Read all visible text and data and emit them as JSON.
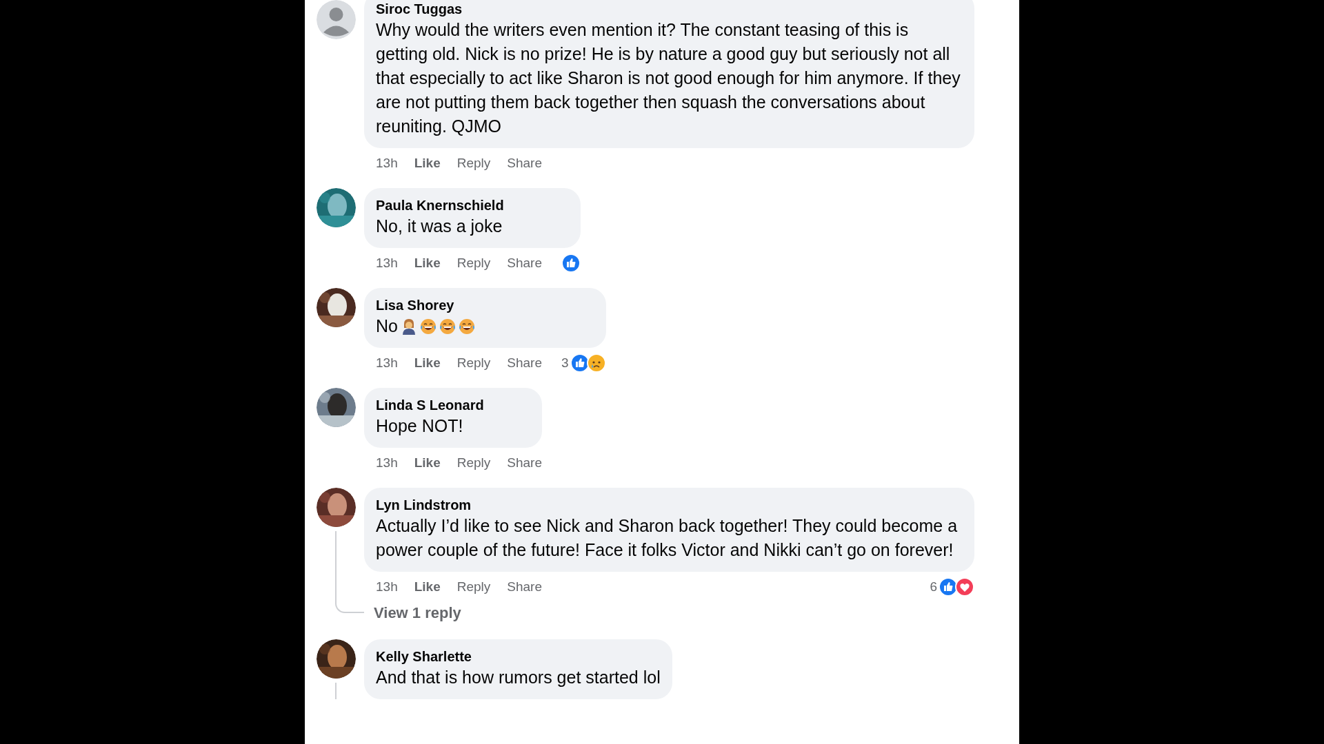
{
  "comments": [
    {
      "author": "Siroc Tuggas",
      "avatar": {
        "kind": "default"
      },
      "text": "Why would the writers even mention it? The constant teasing of this is getting old. Nick is no prize! He is by nature a good guy but seriously not all that especially to act like Sharon is not good enough for him anymore. If they are not putting them back together then squash the conversations about reuniting. QJMO",
      "time": "13h",
      "actions": [
        "Like",
        "Reply",
        "Share"
      ],
      "thread": false
    },
    {
      "author": "Paula Knernschield",
      "avatar": {
        "kind": "picture"
      },
      "text": "No, it was a joke",
      "time": "13h",
      "actions": [
        "Like",
        "Reply",
        "Share"
      ],
      "reactions": {
        "icons": [
          {
            "kind": "like"
          }
        ]
      },
      "thread": false
    },
    {
      "author": "Lisa Shorey",
      "avatar": {
        "kind": "picture"
      },
      "text": "No",
      "emojis": [
        {
          "kind": "person"
        },
        {
          "kind": "laugh"
        },
        {
          "kind": "laugh"
        },
        {
          "kind": "laugh"
        }
      ],
      "time": "13h",
      "actions": [
        "Like",
        "Reply",
        "Share"
      ],
      "reactions": {
        "count": "3",
        "icons": [
          {
            "kind": "like"
          },
          {
            "kind": "sad"
          }
        ]
      },
      "thread": false
    },
    {
      "author": "Linda S Leonard",
      "avatar": {
        "kind": "picture"
      },
      "text": "Hope NOT!",
      "time": "13h",
      "actions": [
        "Like",
        "Reply",
        "Share"
      ],
      "thread": false
    },
    {
      "author": "Lyn Lindstrom",
      "avatar": {
        "kind": "picture"
      },
      "text": "Actually I’d like to see Nick and Sharon back together! They could become a power couple of the future! Face it folks Victor and Nikki can’t go on forever!",
      "time": "13h",
      "actions": [
        "Like",
        "Reply",
        "Share"
      ],
      "reactions": {
        "count": "6",
        "icons": [
          {
            "kind": "like"
          },
          {
            "kind": "love"
          }
        ]
      },
      "thread": true,
      "replies_link": "View 1 reply"
    },
    {
      "author": "Kelly Sharlette",
      "avatar": {
        "kind": "picture"
      },
      "text": "And that is how rumors get started lol",
      "thread": true
    }
  ]
}
